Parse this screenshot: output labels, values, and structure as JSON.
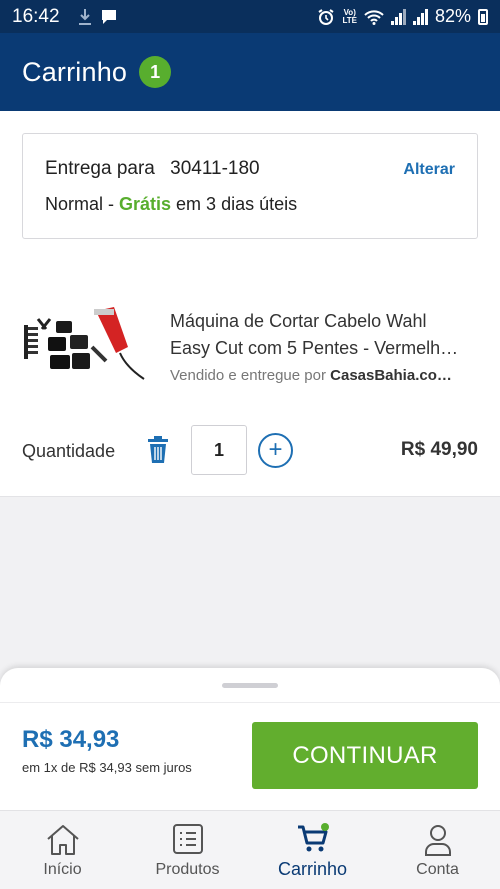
{
  "status_bar": {
    "time": "16:42",
    "battery": "82%",
    "network": "Vo) LTE"
  },
  "header": {
    "title": "Carrinho",
    "item_count": "1"
  },
  "delivery": {
    "label": "Entrega para",
    "cep": "30411-180",
    "change_label": "Alterar",
    "method": "Normal",
    "separator": " - ",
    "free_label": "Grátis",
    "eta": " em 3 dias úteis"
  },
  "product": {
    "name_line1": "Máquina de Cortar Cabelo Wahl",
    "name_line2": "Easy Cut com 5 Pentes - Vermelh…",
    "seller_prefix": "Vendido e entregue por ",
    "seller_name": "CasasBahia.co…",
    "quantity_label": "Quantidade",
    "quantity": "1",
    "price": "R$ 49,90"
  },
  "summary": {
    "total": "R$ 34,93",
    "installments": "em 1x de R$ 34,93 sem juros",
    "continue_label": "CONTINUAR"
  },
  "tabbar": {
    "items": [
      {
        "label": "Início",
        "icon": "home-icon"
      },
      {
        "label": "Produtos",
        "icon": "list-icon"
      },
      {
        "label": "Carrinho",
        "icon": "cart-icon"
      },
      {
        "label": "Conta",
        "icon": "user-icon"
      }
    ],
    "active_index": 2
  },
  "colors": {
    "header": "#0a3a74",
    "status_bar": "#0a2f5c",
    "accent_green": "#58ae2e",
    "link_blue": "#1e6fb3"
  }
}
